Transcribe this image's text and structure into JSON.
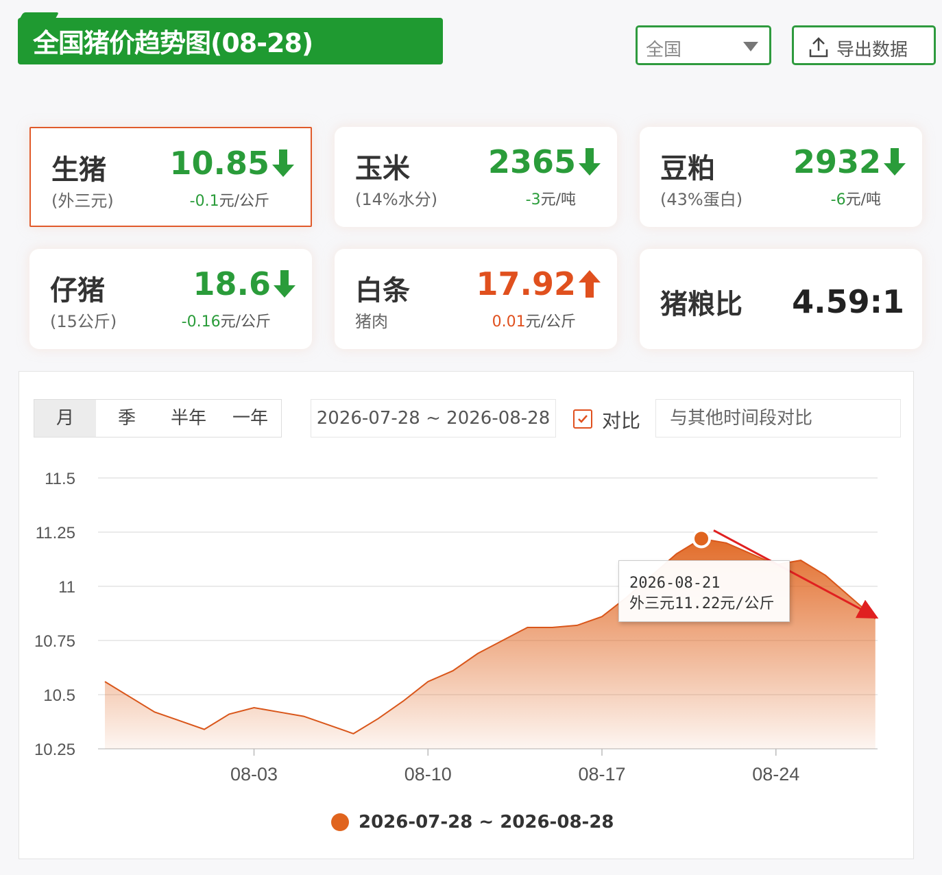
{
  "header": {
    "title": "全国猪价趋势图(08-28)",
    "region_select": "全国",
    "export_label": "导出数据"
  },
  "cards": [
    {
      "name": "生猪",
      "sub": "(外三元)",
      "value": "10.85",
      "direction": "down",
      "change_num": "-0.1",
      "change_unit": "元/公斤"
    },
    {
      "name": "玉米",
      "sub": "(14%水分)",
      "value": "2365",
      "direction": "down",
      "change_num": "-3",
      "change_unit": "元/吨"
    },
    {
      "name": "豆粕",
      "sub": "(43%蛋白)",
      "value": "2932",
      "direction": "down",
      "change_num": "-6",
      "change_unit": "元/吨"
    },
    {
      "name": "仔猪",
      "sub": "(15公斤)",
      "value": "18.6",
      "direction": "down",
      "change_num": "-0.16",
      "change_unit": "元/公斤"
    },
    {
      "name": "白条",
      "sub": "猪肉",
      "value": "17.92",
      "direction": "up",
      "change_num": "0.01",
      "change_unit": "元/公斤"
    },
    {
      "name": "猪粮比",
      "sub": "",
      "value": "4.59:1",
      "direction": "none",
      "change_num": "",
      "change_unit": ""
    }
  ],
  "controls": {
    "tabs": [
      "月",
      "季",
      "半年",
      "一年"
    ],
    "active_tab": "月",
    "date_range": "2026-07-28 ~ 2026-08-28",
    "compare_label": "对比",
    "compare_placeholder": "与其他时间段对比"
  },
  "tooltip": {
    "date": "2026-08-21",
    "text": "外三元11.22元/公斤"
  },
  "legend": {
    "label": "2026-07-28 ~ 2026-08-28"
  },
  "colors": {
    "brand_green": "#1f9a31",
    "accent_red": "#e0501e",
    "area_orange": "#e0641e"
  },
  "chart_data": {
    "type": "area",
    "x": [
      "07-28",
      "07-29",
      "07-30",
      "07-31",
      "08-01",
      "08-02",
      "08-03",
      "08-04",
      "08-05",
      "08-06",
      "08-07",
      "08-08",
      "08-09",
      "08-10",
      "08-11",
      "08-12",
      "08-13",
      "08-14",
      "08-15",
      "08-16",
      "08-17",
      "08-18",
      "08-19",
      "08-20",
      "08-21",
      "08-22",
      "08-23",
      "08-24",
      "08-25",
      "08-26",
      "08-27",
      "08-28"
    ],
    "values": [
      10.56,
      10.49,
      10.42,
      10.38,
      10.34,
      10.41,
      10.44,
      10.42,
      10.4,
      10.36,
      10.32,
      10.39,
      10.47,
      10.56,
      10.61,
      10.69,
      10.75,
      10.81,
      10.81,
      10.82,
      10.86,
      10.95,
      11.05,
      11.15,
      11.22,
      11.2,
      11.15,
      11.1,
      11.12,
      11.05,
      10.95,
      10.85
    ],
    "x_tick_labels": [
      "08-03",
      "08-10",
      "08-17",
      "08-24"
    ],
    "y_ticks": [
      10.25,
      10.5,
      10.75,
      11,
      11.25,
      11.5
    ],
    "y_tick_labels": [
      "10.25",
      "10.5",
      "10.75",
      "11",
      "11.25",
      "11.5"
    ],
    "ylim": [
      10.25,
      11.5
    ],
    "grid": true,
    "series_name": "2026-07-28 ~ 2026-08-28",
    "highlight": {
      "x": "08-21",
      "value": 11.22
    }
  }
}
